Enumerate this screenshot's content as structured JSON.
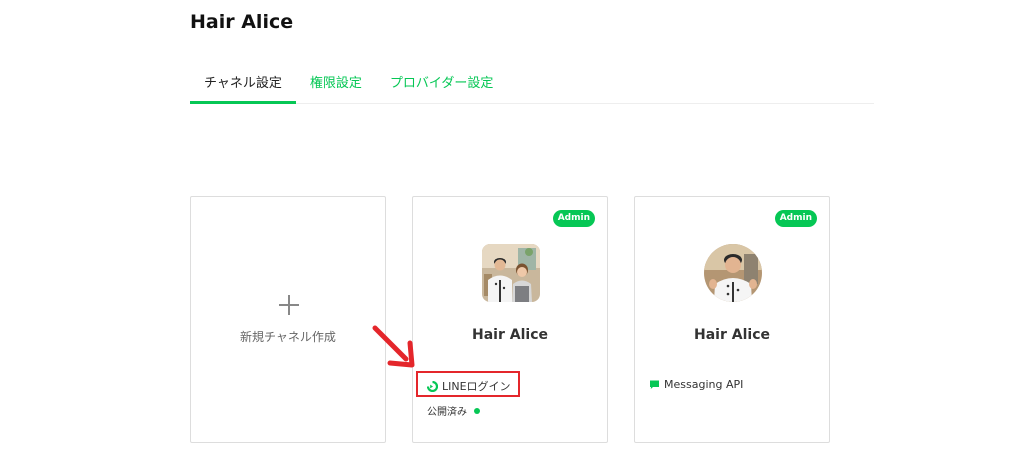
{
  "provider": {
    "title": "Hair Alice"
  },
  "tabs": [
    {
      "label": "チャネル設定",
      "active": true
    },
    {
      "label": "権限設定",
      "active": false
    },
    {
      "label": "プロバイダー設定",
      "active": false
    }
  ],
  "new_channel": {
    "label": "新規チャネル作成",
    "icon": "plus-icon"
  },
  "channels": [
    {
      "name": "Hair Alice",
      "badge": "Admin",
      "type_label": "LINEログイン",
      "type_icon": "line-login-icon",
      "status_label": "公開済み",
      "status_color": "#06c755",
      "avatar_shape": "square"
    },
    {
      "name": "Hair Alice",
      "badge": "Admin",
      "type_label": "Messaging API",
      "type_icon": "messaging-api-icon",
      "avatar_shape": "round"
    }
  ],
  "colors": {
    "accent": "#06c755",
    "highlight": "#e4262b",
    "text": "#222222",
    "muted": "#666666",
    "border": "#dddddd"
  }
}
